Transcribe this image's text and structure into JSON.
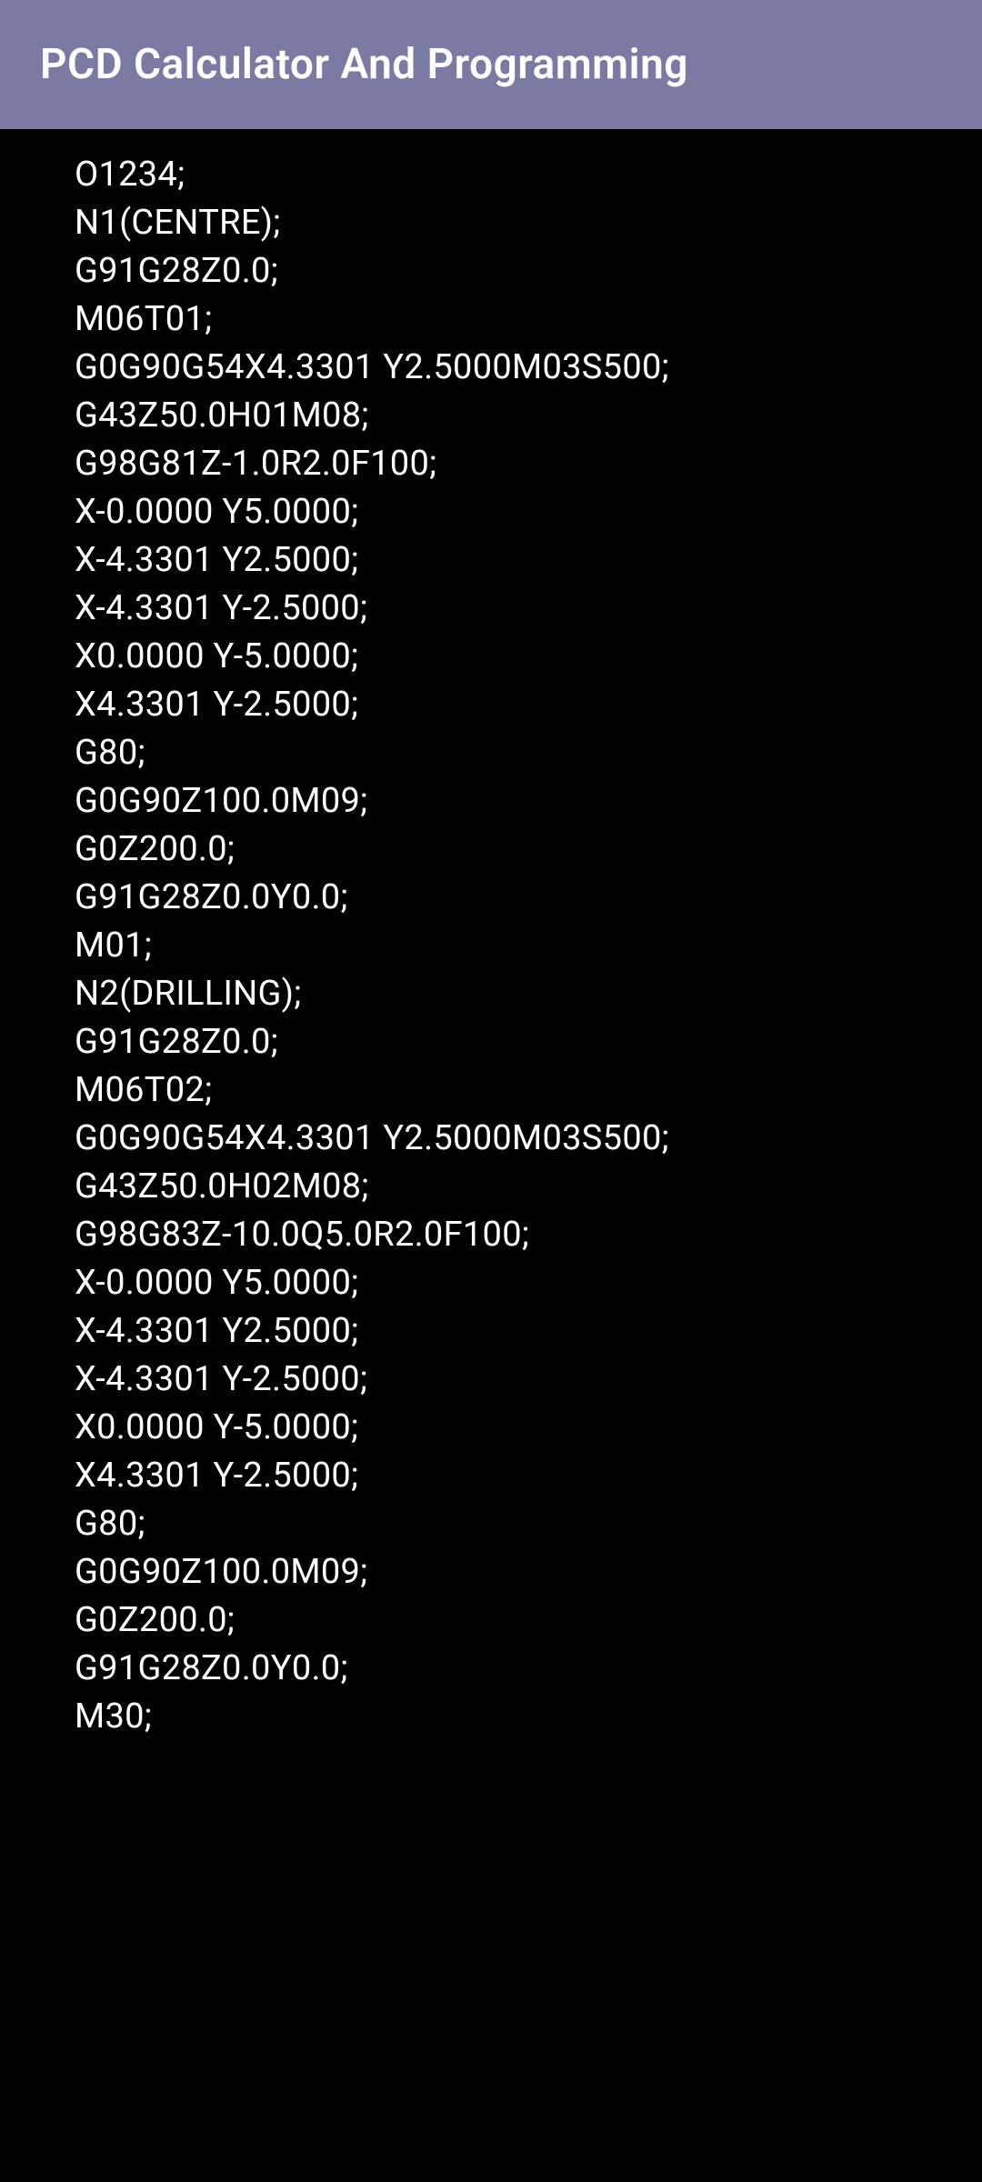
{
  "header": {
    "title": "PCD Calculator And Programming"
  },
  "code": {
    "lines": [
      "O1234;",
      "N1(CENTRE);",
      "G91G28Z0.0;",
      "M06T01;",
      "G0G90G54X4.3301 Y2.5000M03S500;",
      "G43Z50.0H01M08;",
      "G98G81Z-1.0R2.0F100;",
      "X-0.0000 Y5.0000;",
      "X-4.3301 Y2.5000;",
      "X-4.3301 Y-2.5000;",
      "X0.0000 Y-5.0000;",
      "X4.3301 Y-2.5000;",
      "G80;",
      "G0G90Z100.0M09;",
      "G0Z200.0;",
      "G91G28Z0.0Y0.0;",
      "M01;",
      "N2(DRILLING);",
      "G91G28Z0.0;",
      "M06T02;",
      "G0G90G54X4.3301 Y2.5000M03S500;",
      "G43Z50.0H02M08;",
      "G98G83Z-10.0Q5.0R2.0F100;",
      "X-0.0000 Y5.0000;",
      "X-4.3301 Y2.5000;",
      "X-4.3301 Y-2.5000;",
      "X0.0000 Y-5.0000;",
      "X4.3301 Y-2.5000;",
      "G80;",
      "G0G90Z100.0M09;",
      "G0Z200.0;",
      "G91G28Z0.0Y0.0;",
      "M30;"
    ]
  }
}
